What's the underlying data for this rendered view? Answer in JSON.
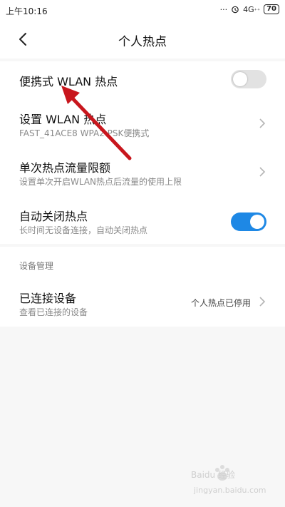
{
  "status": {
    "time": "上午10:16",
    "dots": "···",
    "alarm_icon": "alarm-icon",
    "network": "4G",
    "network_sup": "⁺⁺",
    "battery": "70"
  },
  "header": {
    "title": "个人热点"
  },
  "items": [
    {
      "label": "便携式 WLAN 热点"
    },
    {
      "label": "设置 WLAN 热点",
      "sub": "FAST_41ACE8 WPA2 PSK便携式"
    },
    {
      "label": "单次热点流量限额",
      "sub": "设置单次开启WLAN热点后流量的使用上限"
    },
    {
      "label": "自动关闭热点",
      "sub": "长时间无设备连接，自动关闭热点"
    }
  ],
  "toggles": {
    "portable_hotspot": false,
    "auto_close": true
  },
  "device_section": {
    "header": "设备管理",
    "label": "已连接设备",
    "sub": "查看已连接的设备",
    "value": "个人热点已停用"
  },
  "watermark": {
    "brand": "Baidu 经验",
    "url": "jingyan.baidu.com"
  },
  "colors": {
    "toggle_on": "#1e88e5",
    "toggle_off": "#e2e2e2",
    "arrow": "#c8161d"
  }
}
